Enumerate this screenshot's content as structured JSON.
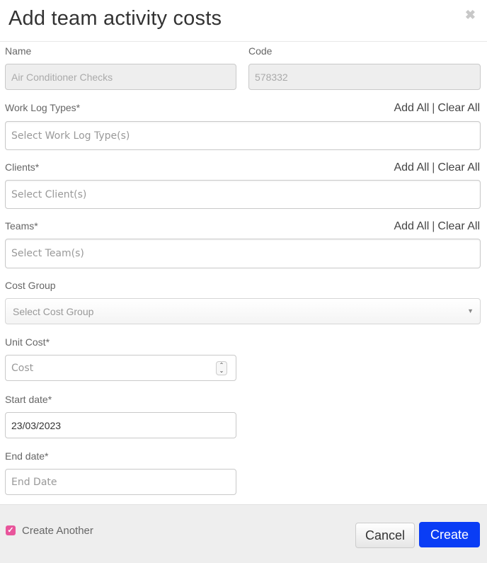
{
  "dialog": {
    "title": "Add team activity costs",
    "close_icon": "close-icon"
  },
  "fields": {
    "name": {
      "label": "Name",
      "value": "Air Conditioner Checks"
    },
    "code": {
      "label": "Code",
      "value": "578332"
    },
    "work_log_types": {
      "label": "Work Log Types*",
      "placeholder": "Select Work Log Type(s)"
    },
    "clients": {
      "label": "Clients*",
      "placeholder": "Select Client(s)"
    },
    "teams": {
      "label": "Teams*",
      "placeholder": "Select Team(s)"
    },
    "cost_group": {
      "label": "Cost Group",
      "placeholder": "Select Cost Group"
    },
    "unit_cost": {
      "label": "Unit Cost*",
      "placeholder": "Cost"
    },
    "start_date": {
      "label": "Start date*",
      "value": "23/03/2023"
    },
    "end_date": {
      "label": "End date*",
      "placeholder": "End Date"
    }
  },
  "links": {
    "add_all": "Add All",
    "separator": "|",
    "clear_all": "Clear All"
  },
  "footer": {
    "create_another_label": "Create Another",
    "create_another_checked": true,
    "cancel_label": "Cancel",
    "create_label": "Create"
  },
  "colors": {
    "primary": "#0a3df5",
    "checkbox": "#e8559b",
    "footer_bg": "#eeeeee"
  }
}
